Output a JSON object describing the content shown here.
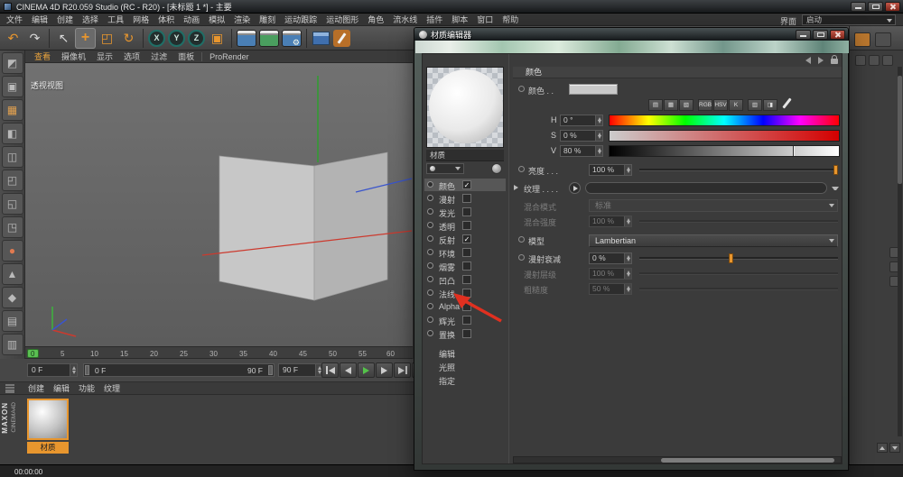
{
  "titlebar": {
    "title": "CINEMA 4D R20.059 Studio (RC - R20) - [未标题 1 *] - 主要"
  },
  "menubar": {
    "items": [
      "文件",
      "编辑",
      "创建",
      "选择",
      "工具",
      "网格",
      "体积",
      "动画",
      "模拟",
      "渲染",
      "雕刻",
      "运动跟踪",
      "运动图形",
      "角色",
      "流水线",
      "插件",
      "脚本",
      "窗口",
      "帮助"
    ],
    "interface_label": "界面",
    "interface_value": "启动"
  },
  "toolbar": {
    "icons": {
      "undo": "↶",
      "redo": "↷",
      "live_selection": "↖",
      "move": "+",
      "scale": "◰",
      "rotate": "↻",
      "axis_x": "X",
      "axis_y": "Y",
      "axis_z": "Z",
      "coord": "▣",
      "gear": "⚙"
    }
  },
  "left_toolbar": {
    "glyphs": [
      "◩",
      "▣",
      "▦",
      "◧",
      "◫",
      "◰",
      "◱",
      "◳",
      "●",
      "▲",
      "◆",
      "▤",
      "▥"
    ]
  },
  "viewport": {
    "menu": [
      "查看",
      "摄像机",
      "显示",
      "选项",
      "过滤",
      "面板",
      "ProRender"
    ],
    "view_label": "透视视图"
  },
  "timeline": {
    "ticks": [
      "0",
      "5",
      "10",
      "15",
      "20",
      "25",
      "30",
      "35",
      "40",
      "45",
      "50",
      "55",
      "60"
    ]
  },
  "transport": {
    "start": "0 F",
    "range_start": "0 F",
    "range_end": "90 F",
    "end": "90 F",
    "loop": "↻"
  },
  "materials_panel": {
    "menu": [
      "创建",
      "编辑",
      "功能",
      "纹理"
    ],
    "material_name": "材质",
    "brand": "MAXON",
    "brand2": "CINEMA4D"
  },
  "statusbar": {
    "time": "00:00:00"
  },
  "dialog": {
    "title": "材质编辑器",
    "preview_label": "材质",
    "channels": [
      {
        "label": "颜色",
        "check": "✓"
      },
      {
        "label": "漫射",
        "check": ""
      },
      {
        "label": "发光",
        "check": ""
      },
      {
        "label": "透明",
        "check": ""
      },
      {
        "label": "反射",
        "check": "✓"
      },
      {
        "label": "环境",
        "check": ""
      },
      {
        "label": "烟雾",
        "check": ""
      },
      {
        "label": "凹凸",
        "check": ""
      },
      {
        "label": "法线",
        "check": ""
      },
      {
        "label": "Alpha",
        "check": ""
      },
      {
        "label": "辉光",
        "check": ""
      },
      {
        "label": "置换",
        "check": ""
      }
    ],
    "actions": [
      "编辑",
      "光照",
      "指定"
    ],
    "color_panel": {
      "header": "颜色",
      "color_label": "颜色 . .",
      "mode_buttons": [
        "▤",
        "▦",
        "▧",
        "RGB",
        "HSV",
        "K",
        "▥",
        "◨"
      ],
      "h_label": "H",
      "h_value": "0 °",
      "s_label": "S",
      "s_value": "0 %",
      "v_label": "V",
      "v_value": "80 %",
      "brightness_label": "亮度 . . .",
      "brightness_value": "100 %",
      "texture_label": "纹理 . . . .",
      "mix_mode_label": "混合模式",
      "mix_mode_value": "标准",
      "mix_strength_label": "混合强度",
      "mix_strength_value": "100 %",
      "model_label": "模型",
      "model_value": "Lambertian",
      "falloff_label": "漫射衰减",
      "falloff_value": "0 %",
      "level_label": "漫射层级",
      "level_value": "100 %",
      "roughness_label": "粗糙度",
      "roughness_value": "50 %"
    }
  },
  "colors": {
    "accent": "#e8962e",
    "play_green": "#54c24a",
    "timeline_marker": "#5abf52",
    "annotation_arrow": "#e03020"
  }
}
